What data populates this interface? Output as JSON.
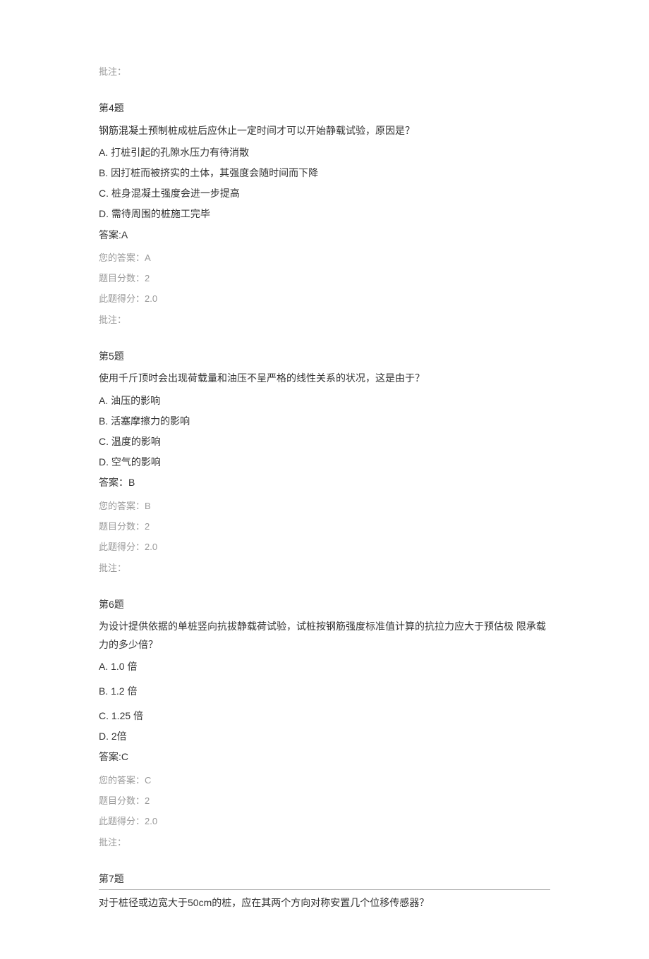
{
  "intro_comment": "批注：",
  "questions": [
    {
      "title": "第4题",
      "text": "钢筋混凝土预制桩成桩后应休止一定时间才可以开始静载试验，原因是？",
      "options": [
        "A.  打桩引起的孔隙水压力有待消散",
        "B.  因打桩而被挤实的土体，其强度会随时间而下降",
        "C.  桩身混凝土强度会进一步提高",
        "D.  需待周围的桩施工完毕"
      ],
      "answer": "答案:A",
      "your_answer": "您的答案：A",
      "score_total": "题目分数：2",
      "score_got": "此题得分：2.0",
      "comment": "批注："
    },
    {
      "title": "第5题",
      "text": "使用千斤顶时会出现荷载量和油压不呈严格的线性关系的状况，这是由于？",
      "options": [
        "A.  油压的影响",
        "B.  活塞摩擦力的影响",
        "C.  温度的影响",
        "D.  空气的影响"
      ],
      "answer": "答案：B",
      "your_answer": "您的答案：B",
      "score_total": "题目分数：2",
      "score_got": "此题得分：2.0",
      "comment": "批注："
    },
    {
      "title": "第6题",
      "text": "为设计提供依据的单桩竖向抗拔静载荷试验，试桩按钢筋强度标准值计算的抗拉力应大于预估极  限承载力的多少倍？",
      "options": [
        "A.  1.0 倍",
        "B.  1.2 倍",
        "C.  1.25 倍",
        "D.  2倍"
      ],
      "answer": "答案:C",
      "your_answer": "您的答案：C",
      "score_total": "题目分数：2",
      "score_got": "此题得分：2.0",
      "comment": "批注："
    }
  ],
  "q7": {
    "title": "第7题",
    "text": "对于桩径或边宽大于50cm的桩，应在其两个方向对称安置几个位移传感器？"
  }
}
